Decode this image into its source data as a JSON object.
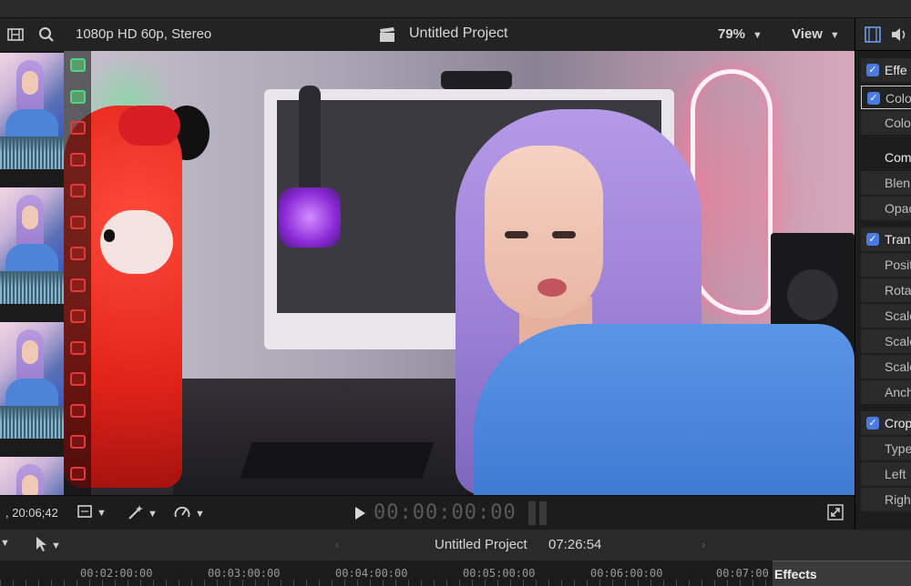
{
  "viewer": {
    "format": "1080p HD 60p, Stereo",
    "project_title": "Untitled Project",
    "zoom": "79%",
    "view_menu": "View"
  },
  "inspector": {
    "rows": [
      {
        "label": "Effe",
        "checked": true,
        "kind": "head"
      },
      {
        "label": "Colo",
        "checked": true,
        "kind": "selected"
      },
      {
        "label": "Colo",
        "checked": false,
        "kind": "selected-sub"
      },
      {
        "label": "Com",
        "checked": false,
        "kind": "section"
      },
      {
        "label": "Blen",
        "checked": false,
        "kind": "plain"
      },
      {
        "label": "Opac",
        "checked": false,
        "kind": "plain"
      },
      {
        "label": "Trans",
        "checked": true,
        "kind": "head"
      },
      {
        "label": "Posit",
        "checked": false,
        "kind": "plain"
      },
      {
        "label": "Rota",
        "checked": false,
        "kind": "plain"
      },
      {
        "label": "Scale",
        "checked": false,
        "kind": "plain"
      },
      {
        "label": "Scale",
        "checked": false,
        "kind": "plain"
      },
      {
        "label": "Scale",
        "checked": false,
        "kind": "plain"
      },
      {
        "label": "Anch",
        "checked": false,
        "kind": "plain"
      },
      {
        "label": "Crop",
        "checked": true,
        "kind": "head"
      },
      {
        "label": "Type",
        "checked": false,
        "kind": "plain"
      },
      {
        "label": "Left",
        "checked": false,
        "kind": "plain"
      },
      {
        "label": "Right",
        "checked": false,
        "kind": "plain"
      }
    ]
  },
  "transport": {
    "clip_timecode": ", 20:06;42",
    "playhead_timecode": "00:00:00:00"
  },
  "timeline": {
    "project_name": "Untitled Project",
    "duration": "07:26:54",
    "ruler": [
      "00:02:00:00",
      "00:03:00:00",
      "00:04:00:00",
      "00:05:00:00",
      "00:06:00:00",
      "00:07:00"
    ],
    "effects_tab": "Effects"
  },
  "colors": {
    "accent_blue": "#4b7ae0",
    "sprocket_red": "#e23a3a",
    "sprocket_green": "#4fd67a"
  }
}
